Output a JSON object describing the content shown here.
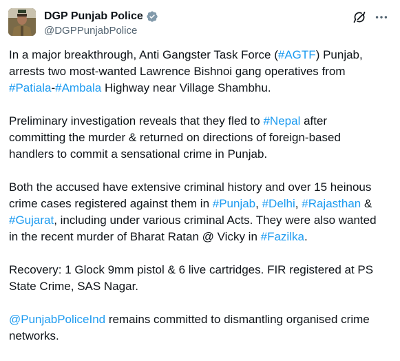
{
  "author": {
    "display_name": "DGP Punjab Police",
    "handle": "@DGPPunjabPolice",
    "verified_badge_color": "#829aab",
    "icons": {
      "verified": "verified-badge-icon",
      "grok": "grok-icon",
      "more": "more-options-icon",
      "avatar": "avatar"
    }
  },
  "colors": {
    "link": "#1d9bf0",
    "text": "#0f1419",
    "secondary": "#536471"
  },
  "post": {
    "p1": {
      "t1": "In a major breakthrough, Anti Gangster Task Force (",
      "h1": "#AGTF",
      "t2": ") Punjab,\narrests two most-wanted Lawrence Bishnoi gang operatives from\n",
      "h2": "#Patiala",
      "t3": "-",
      "h3": "#Ambala",
      "t4": " Highway near Village Shambhu."
    },
    "p2": {
      "t1": "Preliminary investigation reveals that they fled to ",
      "h1": "#Nepal",
      "t2": " after\ncommitting the murder & returned on directions of foreign-based\nhandlers to commit a sensational crime in Punjab."
    },
    "p3": {
      "t1": "Both the accused have extensive criminal history and over 15 heinous\ncrime cases registered against them in ",
      "h1": "#Punjab",
      "t2": ", ",
      "h2": "#Delhi",
      "t3": ", ",
      "h3": "#Rajasthan",
      "t4": " &\n",
      "h4": "#Gujarat",
      "t5": ", including under various criminal Acts. They were also wanted\nin the recent murder of Bharat Ratan @ Vicky in ",
      "h5": "#Fazilka",
      "t6": "."
    },
    "p4": {
      "t1": "Recovery: 1 Glock 9mm pistol & 6 live cartridges. FIR registered at PS\nState Crime, SAS Nagar."
    },
    "p5": {
      "m1": "@PunjabPoliceInd",
      "t1": " remains committed to dismantling organised crime\nnetworks."
    }
  }
}
